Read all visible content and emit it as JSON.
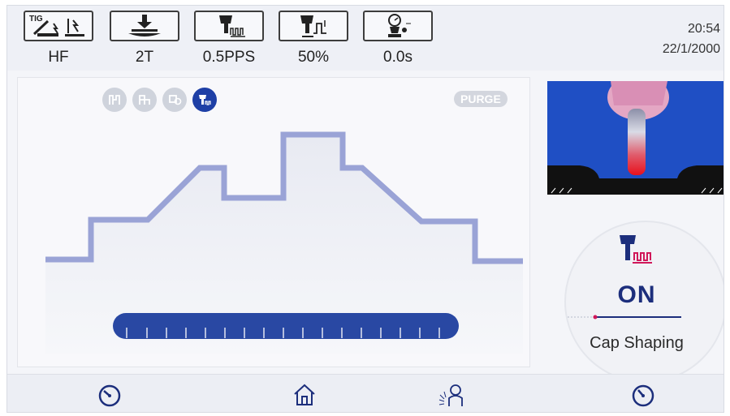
{
  "params": [
    {
      "icon": "tig-hf-icon",
      "value": "HF",
      "badge": "TIG"
    },
    {
      "icon": "trigger-2t-icon",
      "value": "2T"
    },
    {
      "icon": "pulse-frequency-icon",
      "value": "0.5PPS"
    },
    {
      "icon": "pulse-duty-icon",
      "value": "50%"
    },
    {
      "icon": "gas-timer-icon",
      "value": "0.0s"
    }
  ],
  "clock": {
    "time": "20:54",
    "date": "22/1/2000"
  },
  "modes": [
    "mode-1-icon",
    "mode-2-icon",
    "mode-3-icon",
    "cap-shaping-mode-icon"
  ],
  "purge_label": "PURGE",
  "cap": {
    "status": "ON",
    "label": "Cap Shaping"
  },
  "nav": [
    "left-timer-icon",
    "home-icon",
    "welder-icon",
    "right-timer-icon"
  ],
  "colors": {
    "accent": "#1e3fa6",
    "waveform": "#9aa3d6",
    "camera_bg": "#1f4fc4"
  }
}
